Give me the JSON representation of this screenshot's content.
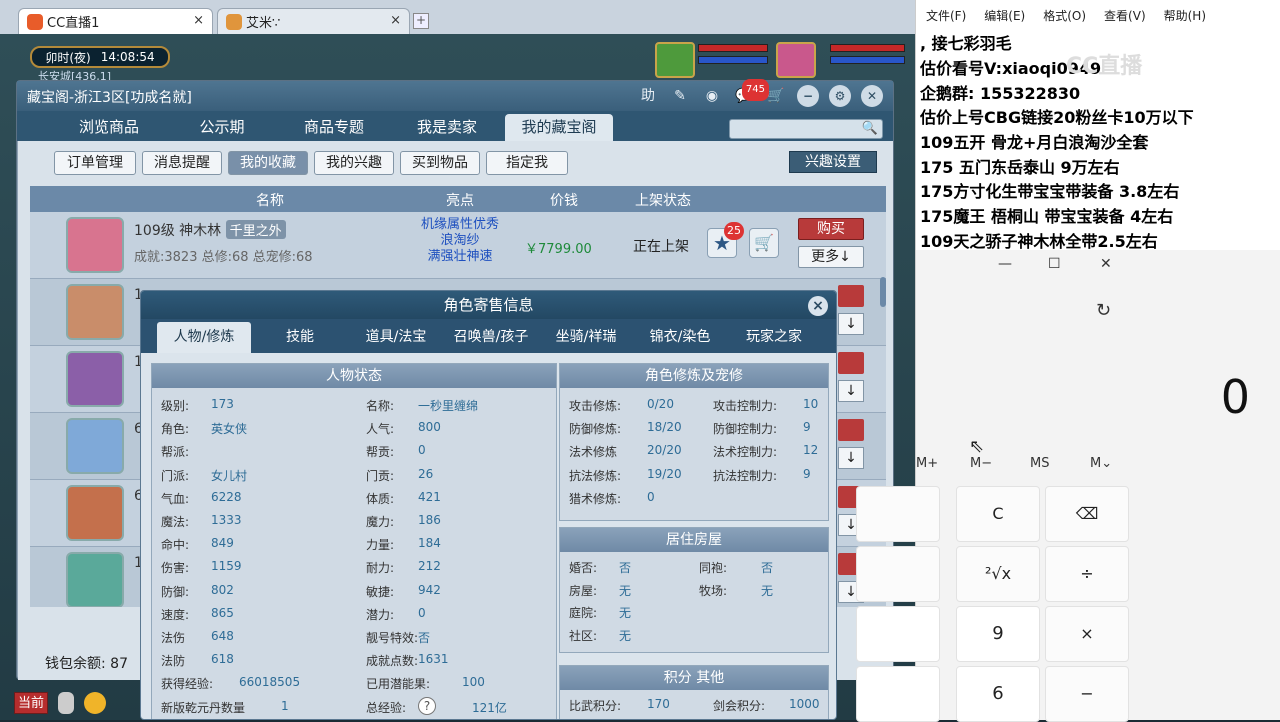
{
  "browser": {
    "tab1_title": "CC直播1",
    "tab2_title": "艾米∵",
    "close": "×",
    "new_tab": "+"
  },
  "hud": {
    "clock_period": "卯时(夜)",
    "clock_time": "14:08:54",
    "map": "长安城[436,1]",
    "current_btn": "当前"
  },
  "window": {
    "title": "藏宝阁-浙江3区[功成名就]",
    "icon_help": "助",
    "msg_count": "745",
    "tabs": [
      "浏览商品",
      "公示期",
      "商品专题",
      "我是卖家",
      "我的藏宝阁"
    ],
    "subtabs": [
      "订单管理",
      "消息提醒",
      "我的收藏",
      "我的兴趣",
      "买到物品",
      "指定我"
    ],
    "interest_btn": "兴趣设置",
    "columns": {
      "name": "名称",
      "highlight": "亮点",
      "price": "价钱",
      "status": "上架状态"
    },
    "first_row": {
      "level_name": "109级  神木林",
      "server_tag": "千里之外",
      "stats": "成就:3823  总修:68  总宠修:68",
      "highlights": [
        "机缘属性优秀",
        "浪淘纱",
        "满强壮神速"
      ],
      "price": "￥7799.00",
      "status": "正在上架",
      "fav_count": "25",
      "buy": "购买",
      "more": "更多↓"
    },
    "row_level_digits": [
      "1",
      "1",
      "6",
      "6",
      "1"
    ],
    "wallet": "钱包余额: 87"
  },
  "popup": {
    "title": "角色寄售信息",
    "close": "×",
    "tabs": [
      "人物/修炼",
      "技能",
      "道具/法宝",
      "召唤兽/孩子",
      "坐骑/祥瑞",
      "锦衣/染色",
      "玩家之家"
    ],
    "status_head": "人物状态",
    "left_col": [
      [
        "级别:",
        "173"
      ],
      [
        "角色:",
        "英女侠"
      ],
      [
        "帮派:",
        ""
      ],
      [
        "门派:",
        "女儿村"
      ],
      [
        "气血:",
        "6228"
      ],
      [
        "魔法:",
        "1333"
      ],
      [
        "命中:",
        "849"
      ],
      [
        "伤害:",
        "1159"
      ],
      [
        "防御:",
        "802"
      ],
      [
        "速度:",
        "865"
      ],
      [
        "法伤",
        "648"
      ],
      [
        "法防",
        "618"
      ],
      [
        "获得经验:",
        "66018505"
      ],
      [
        "新版乾元丹数量",
        "1"
      ]
    ],
    "mid_col": [
      [
        "名称:",
        "一秒里缠绵"
      ],
      [
        "人气:",
        "800"
      ],
      [
        "帮贡:",
        "0"
      ],
      [
        "门贡:",
        "26"
      ],
      [
        "体质:",
        "421"
      ],
      [
        "魔力:",
        "186"
      ],
      [
        "力量:",
        "184"
      ],
      [
        "耐力:",
        "212"
      ],
      [
        "敏捷:",
        "942"
      ],
      [
        "潜力:",
        "0"
      ],
      [
        "靓号特效:",
        "否"
      ],
      [
        "成就点数:",
        "1631"
      ],
      [
        "已用潜能果:",
        "100"
      ],
      [
        "总经验:",
        "121亿"
      ]
    ],
    "cult_head": "角色修炼及宠修",
    "cult": [
      [
        "攻击修炼:",
        "0/20",
        "攻击控制力:",
        "10"
      ],
      [
        "防御修炼:",
        "18/20",
        "防御控制力:",
        "9"
      ],
      [
        "法术修炼",
        "20/20",
        "法术控制力:",
        "12"
      ],
      [
        "抗法修炼:",
        "19/20",
        "抗法控制力:",
        "9"
      ],
      [
        "猎术修炼:",
        "0",
        "",
        ""
      ]
    ],
    "house_head": "居住房屋",
    "house": [
      [
        "婚否:",
        "否",
        "同袍:",
        "否"
      ],
      [
        "房屋:",
        "无",
        "牧场:",
        "无"
      ],
      [
        "庭院:",
        "无",
        "",
        ""
      ],
      [
        "社区:",
        "无",
        "",
        ""
      ]
    ],
    "points_head": "积分 其他",
    "points": [
      "比武积分:",
      "170",
      "剑会积分:",
      "1000"
    ],
    "qmark": "?"
  },
  "notes": {
    "menu": [
      "文件(F)",
      "编辑(E)",
      "格式(O)",
      "查看(V)",
      "帮助(H)"
    ],
    "lines": [
      ",       接七彩羽毛",
      "估价看号V:xiaoqi0949",
      "企鹅群: 155322830",
      "估价上号CBG链接20粉丝卡10万以下",
      "109五开 骨龙+月白浪淘沙全套",
      "175 五门东岳泰山  9万左右",
      "175方寸化生带宝宝带装备  3.8左右",
      "175魔王 梧桐山  带宝宝装备 4左右",
      "109天之骄子神木林全带2.5左右"
    ],
    "watermark": "CC直播"
  },
  "calculator": {
    "display": "0",
    "mem": [
      "M+",
      "M−",
      "MS",
      "M⌄"
    ],
    "keys": [
      "C",
      "⌫",
      "²√x",
      "÷",
      "9",
      "×",
      "6",
      "−"
    ],
    "min": "—",
    "max": "☐",
    "close": "✕",
    "history_icon": "↻"
  }
}
